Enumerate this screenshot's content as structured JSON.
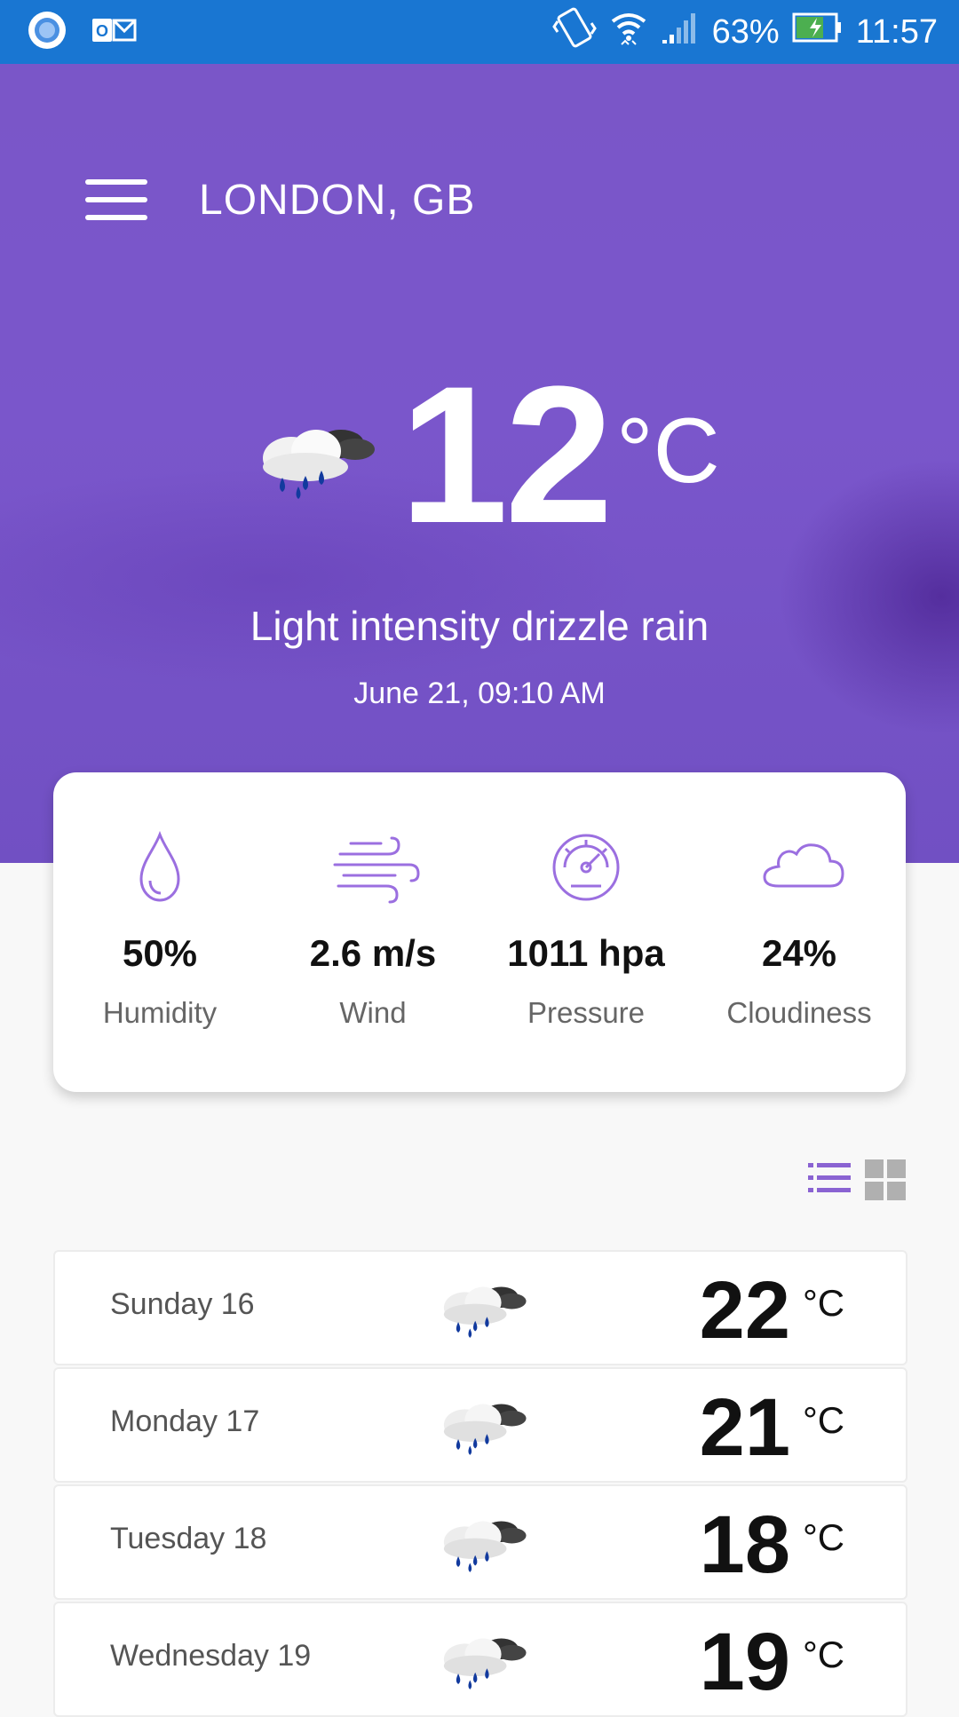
{
  "status_bar": {
    "battery": "63%",
    "time": "11:57",
    "icons": [
      "notification-dot-icon",
      "outlook-icon",
      "vibrate-icon",
      "wifi-icon",
      "signal-icon",
      "battery-charging-icon"
    ]
  },
  "header": {
    "menu_icon": "hamburger-menu-icon",
    "city": "LONDON, GB"
  },
  "current": {
    "icon": "rain-cloud-icon",
    "temperature": "12",
    "unit": "°C",
    "description": "Light intensity drizzle rain",
    "datetime": "June 21, 09:10 AM"
  },
  "details": [
    {
      "icon": "droplet-icon",
      "value": "50%",
      "label": "Humidity"
    },
    {
      "icon": "wind-icon",
      "value": "2.6 m/s",
      "label": "Wind"
    },
    {
      "icon": "gauge-icon",
      "value": "1011 hpa",
      "label": "Pressure"
    },
    {
      "icon": "cloud-icon",
      "value": "24%",
      "label": "Cloudiness"
    }
  ],
  "view_toggle": {
    "list_icon": "list-view-icon",
    "grid_icon": "grid-view-icon"
  },
  "forecast": [
    {
      "day": "Sunday 16",
      "temp": "22",
      "unit": "°C",
      "icon": "rain-cloud-icon"
    },
    {
      "day": "Monday 17",
      "temp": "21",
      "unit": "°C",
      "icon": "rain-cloud-icon"
    },
    {
      "day": "Tuesday 18",
      "temp": "18",
      "unit": "°C",
      "icon": "rain-cloud-icon"
    },
    {
      "day": "Wednesday 19",
      "temp": "19",
      "unit": "°C",
      "icon": "rain-cloud-icon"
    }
  ],
  "colors": {
    "status_bar": "#1976d2",
    "hero": "#7a56c8",
    "accent": "#8a63d2"
  }
}
